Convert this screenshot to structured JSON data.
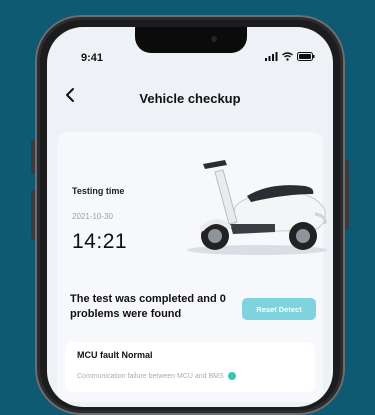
{
  "status_bar": {
    "time": "9:41"
  },
  "header": {
    "title": "Vehicle checkup",
    "back_icon": "chevron-left-icon"
  },
  "test": {
    "label": "Testing time",
    "date": "2021-10-30",
    "clock": "14:21"
  },
  "result": {
    "message": "The test was completed and 0 problems were found",
    "reset_label": "Reset Detect"
  },
  "faults": {
    "title": "MCU fault Normal",
    "items": [
      {
        "text": "Communication failure between MCU and BMS",
        "status_icon": "ok-dot"
      }
    ]
  },
  "colors": {
    "accent": "#7fd3df",
    "ok": "#38c6b2",
    "background": "#0f5a73"
  }
}
